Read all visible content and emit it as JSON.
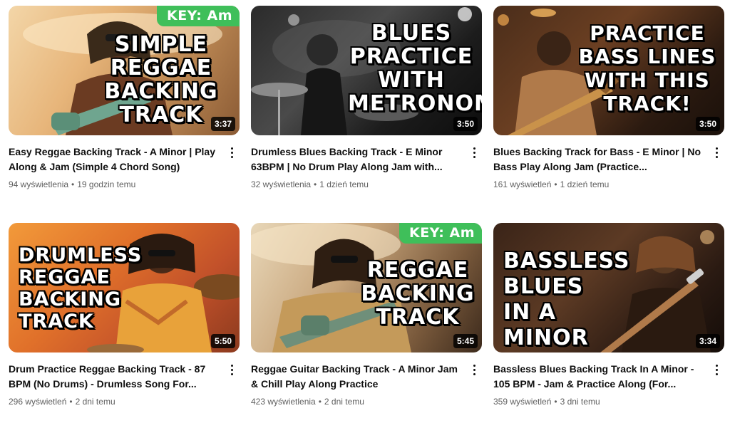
{
  "videos": [
    {
      "title": "Easy Reggae Backing Track - A Minor | Play Along & Jam (Simple 4 Chord Song)",
      "views": "94 wyświetlenia",
      "age": "19 godzin temu",
      "duration": "3:37",
      "thumb_text": "SIMPLE\nREGGAE\nBACKING\nTRACK",
      "key_badge": "KEY: Am"
    },
    {
      "title": "Drumless Blues Backing Track - E Minor 63BPM | No Drum Play Along Jam with...",
      "views": "32 wyświetlenia",
      "age": "1 dzień temu",
      "duration": "3:50",
      "thumb_text": "BLUES\nPRACTICE\nWITH\nMETRONOME"
    },
    {
      "title": "Blues Backing Track for Bass - E Minor | No Bass Play Along Jam (Practice...",
      "views": "161 wyświetleń",
      "age": "1 dzień temu",
      "duration": "3:50",
      "thumb_text": "PRACTICE\nBASS LINES\nWITH THIS\nTRACK!"
    },
    {
      "title": "Drum Practice Reggae Backing Track - 87 BPM (No Drums) - Drumless Song For...",
      "views": "296 wyświetleń",
      "age": "2 dni temu",
      "duration": "5:50",
      "thumb_text": "DRUMLESS\nREGGAE\nBACKING\nTRACK"
    },
    {
      "title": "Reggae Guitar Backing Track - A Minor Jam & Chill Play Along Practice",
      "views": "423 wyświetlenia",
      "age": "2 dni temu",
      "duration": "5:45",
      "thumb_text": "REGGAE\nBACKING\nTRACK",
      "key_badge": "KEY: Am"
    },
    {
      "title": "Bassless Blues Backing Track In A Minor - 105 BPM - Jam & Practice Along (For...",
      "views": "359 wyświetleń",
      "age": "3 dni temu",
      "duration": "3:34",
      "thumb_text": "BASSLESS\nBLUES\nIN A MINOR"
    }
  ],
  "separator": "•"
}
